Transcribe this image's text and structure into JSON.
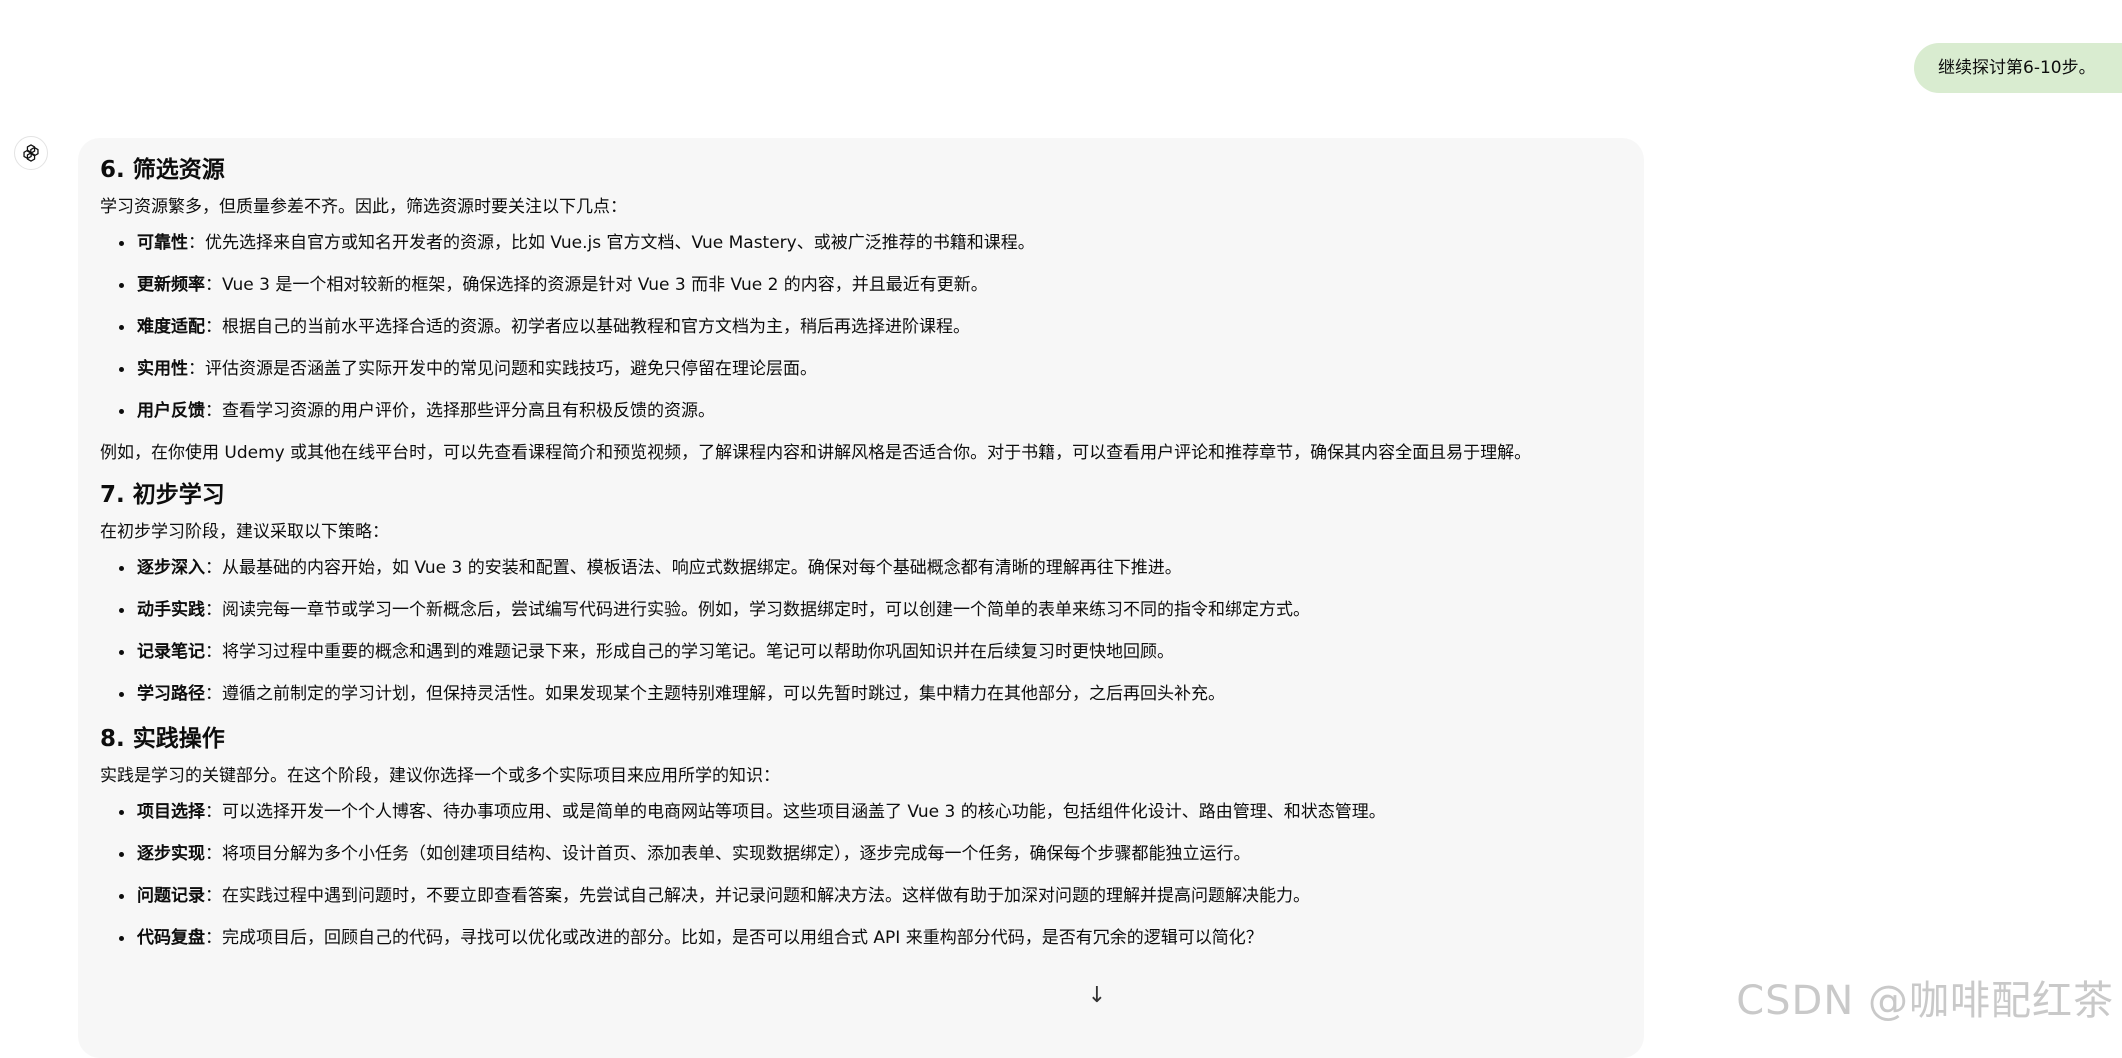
{
  "user_message": "继续探讨第6-10步。",
  "sections": [
    {
      "heading": "6. 筛选资源",
      "intro": "学习资源繁多，但质量参差不齐。因此，筛选资源时要关注以下几点：",
      "items": [
        {
          "term": "可靠性",
          "text": "：优先选择来自官方或知名开发者的资源，比如 Vue.js 官方文档、Vue Mastery、或被广泛推荐的书籍和课程。"
        },
        {
          "term": "更新频率",
          "text": "：Vue 3 是一个相对较新的框架，确保选择的资源是针对 Vue 3 而非 Vue 2 的内容，并且最近有更新。"
        },
        {
          "term": "难度适配",
          "text": "：根据自己的当前水平选择合适的资源。初学者应以基础教程和官方文档为主，稍后再选择进阶课程。"
        },
        {
          "term": "实用性",
          "text": "：评估资源是否涵盖了实际开发中的常见问题和实践技巧，避免只停留在理论层面。"
        },
        {
          "term": "用户反馈",
          "text": "：查看学习资源的用户评价，选择那些评分高且有积极反馈的资源。"
        }
      ],
      "outro": "例如，在你使用 Udemy 或其他在线平台时，可以先查看课程简介和预览视频，了解课程内容和讲解风格是否适合你。对于书籍，可以查看用户评论和推荐章节，确保其内容全面且易于理解。"
    },
    {
      "heading": "7. 初步学习",
      "intro": "在初步学习阶段，建议采取以下策略：",
      "items": [
        {
          "term": "逐步深入",
          "text": "：从最基础的内容开始，如 Vue 3 的安装和配置、模板语法、响应式数据绑定。确保对每个基础概念都有清晰的理解再往下推进。"
        },
        {
          "term": "动手实践",
          "text": "：阅读完每一章节或学习一个新概念后，尝试编写代码进行实验。例如，学习数据绑定时，可以创建一个简单的表单来练习不同的指令和绑定方式。"
        },
        {
          "term": "记录笔记",
          "text": "：将学习过程中重要的概念和遇到的难题记录下来，形成自己的学习笔记。笔记可以帮助你巩固知识并在后续复习时更快地回顾。"
        },
        {
          "term": "学习路径",
          "text": "：遵循之前制定的学习计划，但保持灵活性。如果发现某个主题特别难理解，可以先暂时跳过，集中精力在其他部分，之后再回头补充。"
        }
      ]
    },
    {
      "heading": "8. 实践操作",
      "intro": "实践是学习的关键部分。在这个阶段，建议你选择一个或多个实际项目来应用所学的知识：",
      "items": [
        {
          "term": "项目选择",
          "text": "：可以选择开发一个个人博客、待办事项应用、或是简单的电商网站等项目。这些项目涵盖了 Vue 3 的核心功能，包括组件化设计、路由管理、和状态管理。"
        },
        {
          "term": "逐步实现",
          "text": "：将项目分解为多个小任务（如创建项目结构、设计首页、添加表单、实现数据绑定），逐步完成每一个任务，确保每个步骤都能独立运行。"
        },
        {
          "term": "问题记录",
          "text": "：在实践过程中遇到问题时，不要立即查看答案，先尝试自己解决，并记录问题和解决方法。这样做有助于加深对问题的理解并提高问题解决能力。"
        },
        {
          "term": "代码复盘",
          "text": "：完成项目后，回顾自己的代码，寻找可以优化或改进的部分。比如，是否可以用组合式 API 来重构部分代码，是否有冗余的逻辑可以简化？"
        }
      ]
    }
  ],
  "scroll_down_icon": "↓",
  "watermark": "CSDN @咖啡配红茶"
}
